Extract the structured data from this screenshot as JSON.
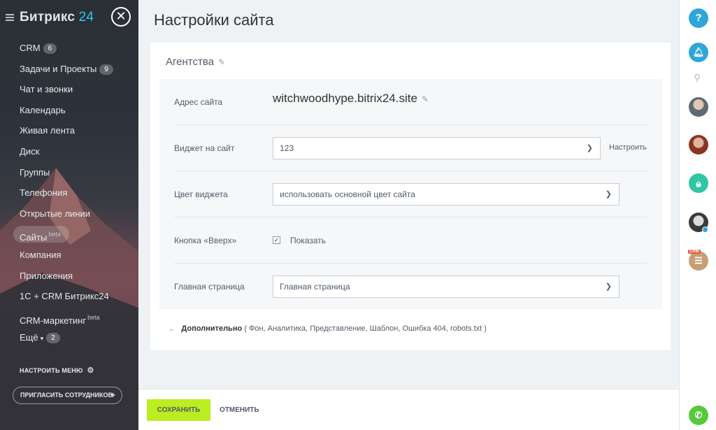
{
  "sidebar": {
    "logo_text": "Битрикс",
    "logo_num": "24",
    "close_symbol": "✕",
    "items": [
      {
        "label": "CRM",
        "counter": "6"
      },
      {
        "label": "Задачи и Проекты",
        "counter": "9"
      },
      {
        "label": "Чат и звонки"
      },
      {
        "label": "Календарь"
      },
      {
        "label": "Живая лента"
      },
      {
        "label": "Диск"
      },
      {
        "label": "Группы"
      },
      {
        "label": "Телефония"
      },
      {
        "label": "Открытые линии"
      },
      {
        "label": "Сайты",
        "sup": "beta",
        "active": true
      },
      {
        "label": "Компания"
      },
      {
        "label": "Приложения"
      },
      {
        "label": "1С + CRM Битрикс24"
      },
      {
        "label": "CRM-маркетинг",
        "sup": "beta"
      },
      {
        "label": "Ещё",
        "counter": "2"
      }
    ],
    "configure_menu": "НАСТРОИТЬ МЕНЮ",
    "invite": "ПРИГЛАСИТЬ СОТРУДНИКОВ"
  },
  "main": {
    "title": "Настройки сайта",
    "card_title": "Агентства",
    "rows": {
      "address_label": "Адрес сайта",
      "address_value": "witchwoodhype.bitrix24.site",
      "widget_label": "Виджет на сайт",
      "widget_value": "123",
      "widget_setup": "Настроить",
      "color_label": "Цвет виджета",
      "color_value": "использовать основной цвет сайта",
      "up_label": "Кнопка «Вверх»",
      "up_checkbox_label": "Показать",
      "up_checked": true,
      "home_label": "Главная страница",
      "home_value": "Главная страница"
    },
    "more_label": "Дополнительно",
    "more_items": "( Фон,  Аналитика,  Представление,  Шаблон,  Ошибка 404,  robots.txt )"
  },
  "footer": {
    "save": "СОХРАНИТЬ",
    "cancel": "ОТМЕНИТЬ"
  },
  "right_panel": {
    "help": "?",
    "crm_tag": "CRM",
    "icons": [
      "help-icon",
      "bell-icon",
      "search-icon",
      "avatar",
      "avatar",
      "lock-icon",
      "avatar",
      "crm-chat-icon",
      "phone-icon"
    ]
  },
  "colors": {
    "accent_blue": "#2fa6d8",
    "save_green": "#bbed21",
    "brand_cyan": "#2fc6f6"
  }
}
